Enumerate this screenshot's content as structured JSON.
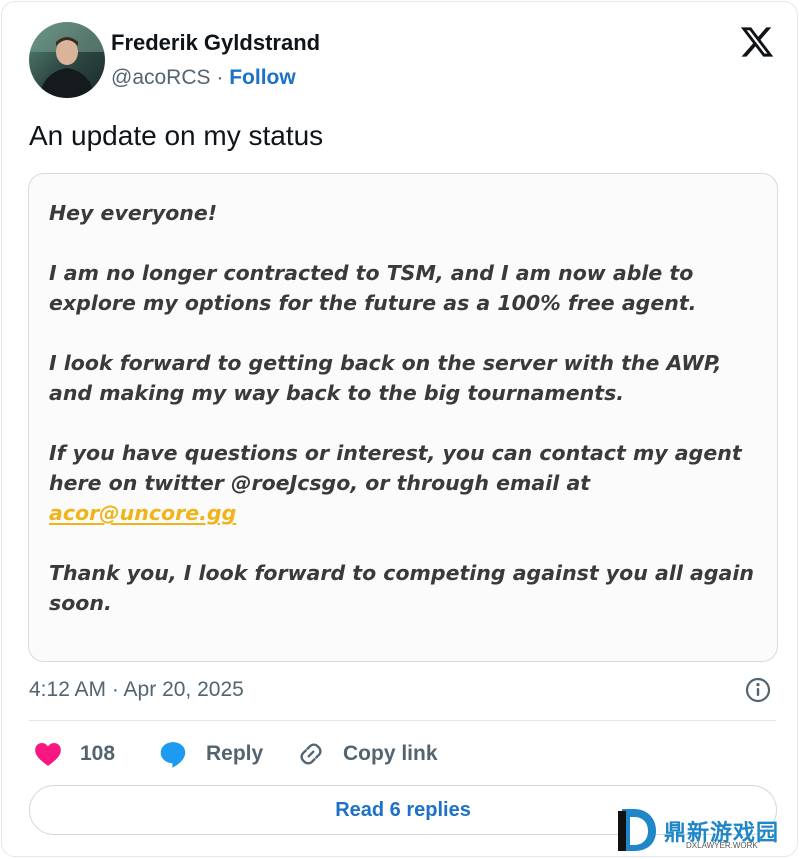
{
  "author": {
    "name": "Frederik Gyldstrand",
    "handle": "@acoRCS",
    "separator": "·",
    "follow_label": "Follow"
  },
  "tweet": {
    "text": "An update on my status",
    "image_statement": {
      "greeting": "Hey everyone!",
      "para1": "I am no longer contracted to TSM, and I am now able to\nexplore my options for the future as a 100% free agent.",
      "para2": "I look forward to getting back on the server with the AWP,\nand making my way back to the big tournaments.",
      "para3_text": "If you have questions or interest, you can contact my agent\nhere on twitter @roeJcsgo, or through email at\n",
      "email": "acor@uncore.gg",
      "para4": "Thank you, I look forward to competing against you all again\nsoon."
    },
    "timestamp": "4:12 AM · Apr 20, 2025"
  },
  "actions": {
    "like_count": "108",
    "reply_label": "Reply",
    "copy_label": "Copy link"
  },
  "read_replies_label": "Read 6 replies",
  "watermark": {
    "title": "鼎新游戏园",
    "sub": "DXLAWYER.WORK"
  },
  "icons": {
    "logo": "x-logo-icon",
    "like": "heart-icon",
    "reply": "speech-bubble-icon",
    "copy": "link-icon",
    "info": "info-icon"
  },
  "colors": {
    "accent": "#1d72c8",
    "like": "#f91880",
    "reply_icon": "#1d9bf0",
    "email_highlight": "#f0b419"
  }
}
